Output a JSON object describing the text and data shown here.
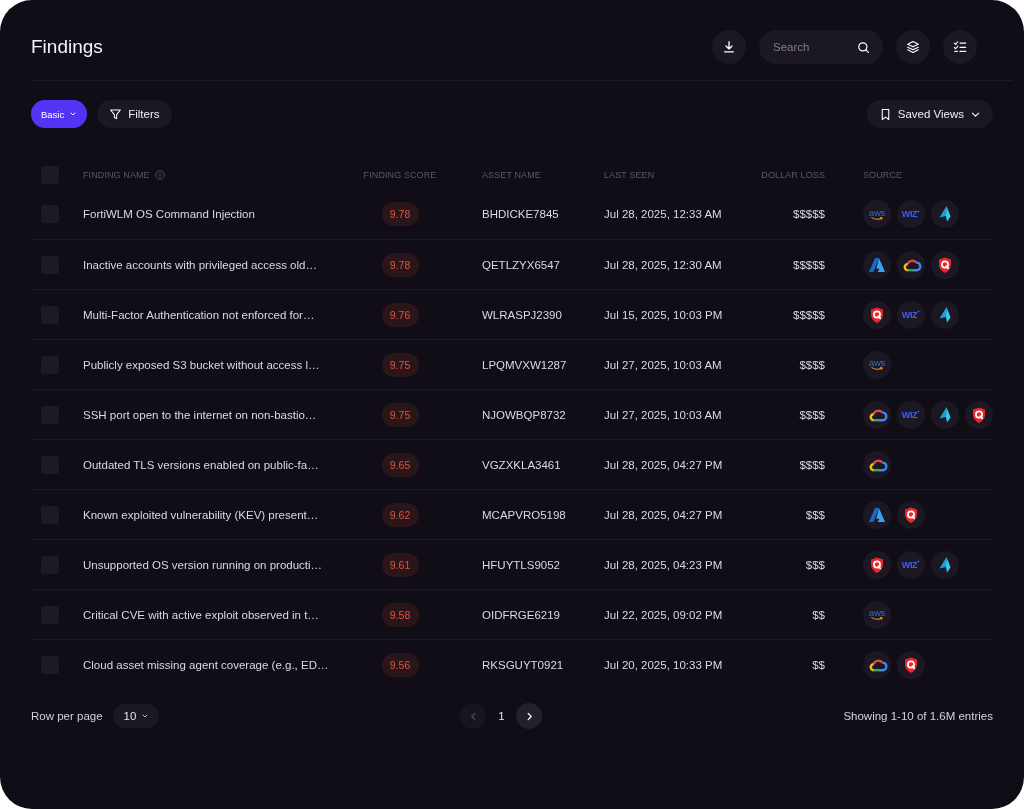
{
  "header": {
    "title": "Findings",
    "search": {
      "placeholder": "Search"
    }
  },
  "toolbar": {
    "view_button": {
      "label": "Basic"
    },
    "filters_button": {
      "label": "Filters"
    },
    "saved_views_button": {
      "label": "Saved Views"
    }
  },
  "table": {
    "select_all": {
      "checked": false
    },
    "columns": [
      {
        "label": "FINDING NAME",
        "info": true
      },
      {
        "label": "FINDING SCORE",
        "info": false
      },
      {
        "label": "ASSET NAME",
        "info": false
      },
      {
        "label": "LAST SEEN",
        "info": false
      },
      {
        "label": "DOLLAR LOSS",
        "info": false
      },
      {
        "label": "SOURCE",
        "info": false
      }
    ],
    "rows": [
      {
        "checked": false,
        "finding_name": "FortiWLM OS Command Injection",
        "score": "9.78",
        "asset_name": "BHDICKE7845",
        "last_seen": "Jul 28, 2025, 12:33 AM",
        "dollar_loss": "$$$$$",
        "sources": [
          {
            "kind": "aws",
            "label": "aws"
          },
          {
            "kind": "wiz",
            "label": "WIZ"
          },
          {
            "kind": "arrow"
          }
        ]
      },
      {
        "checked": false,
        "finding_name": "Inactive accounts with privileged access old…",
        "score": "9.78",
        "asset_name": "QETLZYX6547",
        "last_seen": "Jul 28, 2025, 12:30 AM",
        "dollar_loss": "$$$$$",
        "sources": [
          {
            "kind": "azure"
          },
          {
            "kind": "gcp"
          },
          {
            "kind": "qualys"
          }
        ]
      },
      {
        "checked": false,
        "finding_name": "Multi-Factor Authentication not enforced for…",
        "score": "9.76",
        "asset_name": "WLRASPJ2390",
        "last_seen": "Jul 15, 2025, 10:03 PM",
        "dollar_loss": "$$$$$",
        "sources": [
          {
            "kind": "qualys"
          },
          {
            "kind": "wiz",
            "label": "WIZ"
          },
          {
            "kind": "arrow"
          }
        ]
      },
      {
        "checked": false,
        "finding_name": "Publicly exposed S3 bucket without access l…",
        "score": "9.75",
        "asset_name": "LPQMVXW1287",
        "last_seen": "Jul 27, 2025, 10:03 AM",
        "dollar_loss": "$$$$",
        "sources": [
          {
            "kind": "aws",
            "label": "aws"
          }
        ]
      },
      {
        "checked": false,
        "finding_name": "SSH port open to the internet on non-bastio…",
        "score": "9.75",
        "asset_name": "NJOWBQP8732",
        "last_seen": "Jul 27, 2025, 10:03 AM",
        "dollar_loss": "$$$$",
        "sources": [
          {
            "kind": "gcp"
          },
          {
            "kind": "wiz",
            "label": "WIZ"
          },
          {
            "kind": "arrow"
          },
          {
            "kind": "qualys"
          }
        ]
      },
      {
        "checked": false,
        "finding_name": "Outdated TLS versions enabled on public-fa…",
        "score": "9.65",
        "asset_name": "VGZXKLA3461",
        "last_seen": "Jul 28, 2025, 04:27 PM",
        "dollar_loss": "$$$$",
        "sources": [
          {
            "kind": "gcp"
          }
        ]
      },
      {
        "checked": false,
        "finding_name": "Known exploited vulnerability (KEV) present…",
        "score": "9.62",
        "asset_name": "MCAPVRO5198",
        "last_seen": "Jul 28, 2025, 04:27 PM",
        "dollar_loss": "$$$",
        "sources": [
          {
            "kind": "azure"
          },
          {
            "kind": "qualys"
          }
        ]
      },
      {
        "checked": false,
        "finding_name": "Unsupported OS version running on producti…",
        "score": "9.61",
        "asset_name": "HFUYTLS9052",
        "last_seen": "Jul 28, 2025, 04:23 PM",
        "dollar_loss": "$$$",
        "sources": [
          {
            "kind": "qualys"
          },
          {
            "kind": "wiz",
            "label": "WIZ"
          },
          {
            "kind": "arrow"
          }
        ]
      },
      {
        "checked": false,
        "finding_name": "Critical CVE with active exploit observed in t…",
        "score": "9.58",
        "asset_name": "OIDFRGE6219",
        "last_seen": "Jul 22, 2025, 09:02 PM",
        "dollar_loss": "$$",
        "sources": [
          {
            "kind": "aws",
            "label": "aws"
          }
        ]
      },
      {
        "checked": false,
        "finding_name": "Cloud asset missing agent coverage (e.g., ED…",
        "score": "9.56",
        "asset_name": "RKSGUYT0921",
        "last_seen": "Jul 20, 2025, 10:33 PM",
        "dollar_loss": "$$",
        "sources": [
          {
            "kind": "gcp"
          },
          {
            "kind": "qualys"
          }
        ]
      }
    ]
  },
  "footer": {
    "rows_per_page": {
      "label": "Row per page",
      "value": "10"
    },
    "pagination": {
      "prev": {
        "disabled": true
      },
      "current_page": "1",
      "next": {
        "disabled": false
      }
    },
    "summary": "Showing 1-10 of 1.6M entries"
  }
}
